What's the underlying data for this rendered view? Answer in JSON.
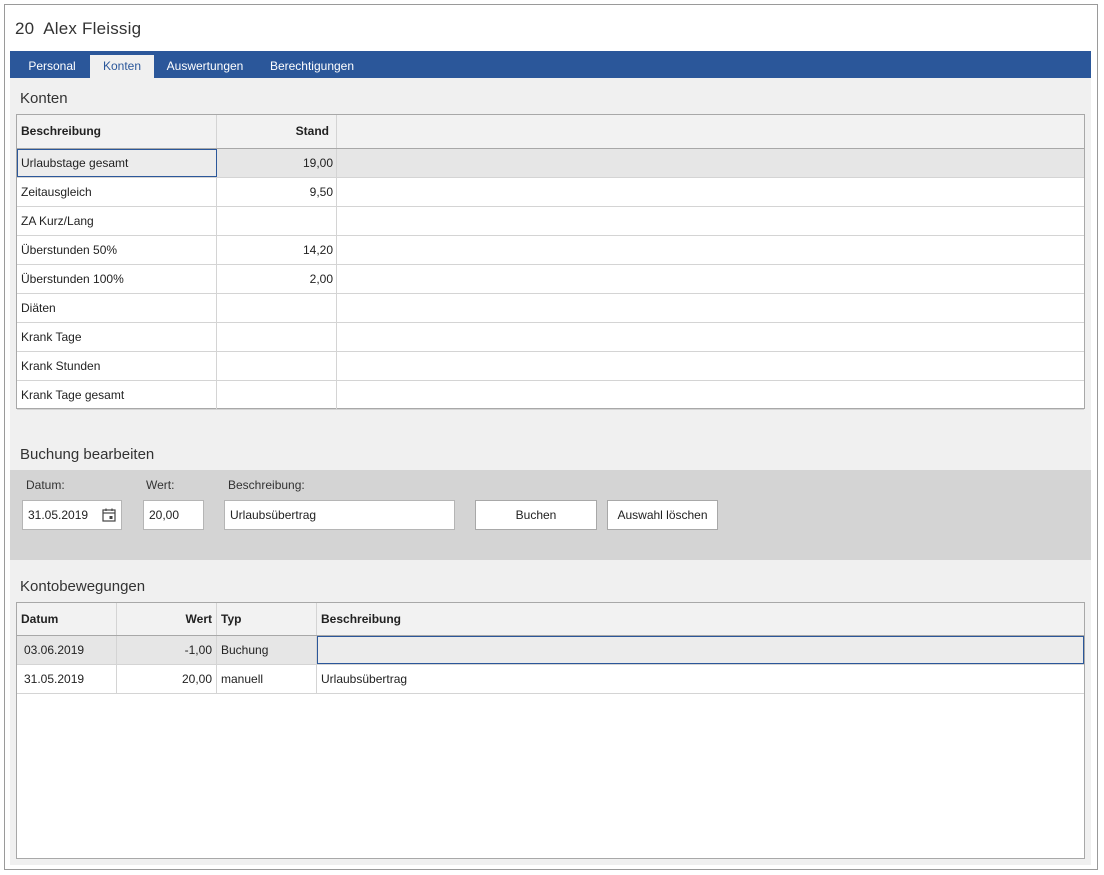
{
  "header": {
    "employee_no": "20",
    "employee_name": "Alex Fleissig"
  },
  "tabs": [
    {
      "label": "Personal",
      "active": false
    },
    {
      "label": "Konten",
      "active": true
    },
    {
      "label": "Auswertungen",
      "active": false
    },
    {
      "label": "Berechtigungen",
      "active": false
    }
  ],
  "konten": {
    "title": "Konten",
    "columns": [
      "Beschreibung",
      "Stand"
    ],
    "rows": [
      {
        "beschreibung": "Urlaubstage gesamt",
        "stand": "19,00"
      },
      {
        "beschreibung": "Zeitausgleich",
        "stand": "9,50"
      },
      {
        "beschreibung": "ZA Kurz/Lang",
        "stand": ""
      },
      {
        "beschreibung": "Überstunden 50%",
        "stand": "14,20"
      },
      {
        "beschreibung": "Überstunden 100%",
        "stand": "2,00"
      },
      {
        "beschreibung": "Diäten",
        "stand": ""
      },
      {
        "beschreibung": "Krank Tage",
        "stand": ""
      },
      {
        "beschreibung": "Krank Stunden",
        "stand": ""
      },
      {
        "beschreibung": "Krank Tage gesamt",
        "stand": ""
      }
    ]
  },
  "buchung": {
    "title": "Buchung bearbeiten",
    "datum_label": "Datum:",
    "datum_value": "31.05.2019",
    "wert_label": "Wert:",
    "wert_value": "20,00",
    "beschreibung_label": "Beschreibung:",
    "beschreibung_value": "Urlaubsübertrag",
    "buchen_label": "Buchen",
    "auswahl_loeschen_label": "Auswahl löschen"
  },
  "kontobewegungen": {
    "title": "Kontobewegungen",
    "columns": [
      "Datum",
      "Wert",
      "Typ",
      "Beschreibung"
    ],
    "rows": [
      {
        "datum": "03.06.2019",
        "wert": "-1,00",
        "typ": "Buchung",
        "beschreibung": ""
      },
      {
        "datum": "31.05.2019",
        "wert": "20,00",
        "typ": "manuell",
        "beschreibung": "Urlaubsübertrag"
      }
    ]
  },
  "colors": {
    "accent": "#2b579a",
    "panel": "#f0f0f0",
    "form_band": "#d4d4d4"
  }
}
